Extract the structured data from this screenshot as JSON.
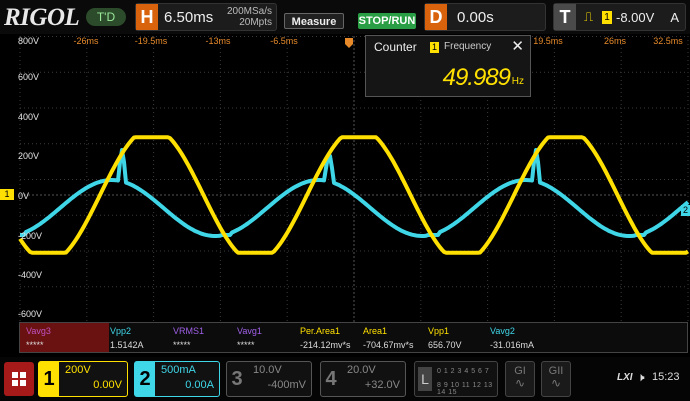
{
  "topbar": {
    "logo": "RIGOL",
    "run_state": "T'D",
    "horizontal": {
      "letter": "H",
      "timebase": "6.50ms",
      "sample_rate": "200MSa/s",
      "memory_depth": "20Mpts"
    },
    "measure_label": "Measure",
    "stoprun_label": "STOP/RUN",
    "delay": {
      "letter": "D",
      "value": "0.00s"
    },
    "trigger": {
      "letter": "T",
      "icon": "rising-edge-icon",
      "source": "1",
      "level": "-8.00V",
      "mode": "A"
    }
  },
  "grid": {
    "time_ticks": [
      "-26ms",
      "-19.5ms",
      "-13ms",
      "-6.5ms",
      "19.5ms",
      "26ms",
      "32.5ms"
    ],
    "volt_labels": [
      "800V",
      "600V",
      "400V",
      "200V",
      "0V",
      "-200V",
      "-400V",
      "-600V"
    ],
    "ch1_marker": "1",
    "ch2_marker": "2"
  },
  "counter": {
    "title": "Counter",
    "channel": "1",
    "mode": "Frequency",
    "value": "49.989",
    "unit": "Hz",
    "close_icon": "close-icon"
  },
  "measurements": [
    {
      "name": "Vavg3",
      "value": "*****",
      "color": "#c050c0"
    },
    {
      "name": "Vpp2",
      "value": "1.5142A",
      "color": "#3fd6e8"
    },
    {
      "name": "VRMS1",
      "value": "*****",
      "color": "#a060e8"
    },
    {
      "name": "Vavg1",
      "value": "*****",
      "color": "#a060e8"
    },
    {
      "name": "Per.Area1",
      "value": "-214.12mv*s",
      "color": "#ffe000"
    },
    {
      "name": "Area1",
      "value": "-704.67mv*s",
      "color": "#ffe000"
    },
    {
      "name": "Vpp1",
      "value": "656.70V",
      "color": "#ffe000"
    },
    {
      "name": "Vavg2",
      "value": "-31.016mA",
      "color": "#3fd6e8"
    }
  ],
  "channels": [
    {
      "num": "1",
      "scale": "200V",
      "offset": "0.00V",
      "color": "#ffe000",
      "active": true
    },
    {
      "num": "2",
      "scale": "500mA",
      "offset": "0.00A",
      "color": "#3fd6e8",
      "active": true
    },
    {
      "num": "3",
      "scale": "10.0V",
      "offset": "-400mV",
      "color": "#777777",
      "active": false
    },
    {
      "num": "4",
      "scale": "20.0V",
      "offset": "+32.0V",
      "color": "#777777",
      "active": false
    }
  ],
  "bottombar": {
    "logic_label": "L",
    "logic_row1": "0 1 2 3 4 5 6 7",
    "logic_row2": "8 9 10 11 12 13 14 15",
    "gen1_label": "GI",
    "gen2_label": "GII",
    "lxi_label": "LXI",
    "speaker_icon": "speaker-icon",
    "time": "15:23"
  },
  "colors": {
    "ch1": "#ffe000",
    "ch2": "#3fd6e8",
    "accent": "#d9620c"
  }
}
